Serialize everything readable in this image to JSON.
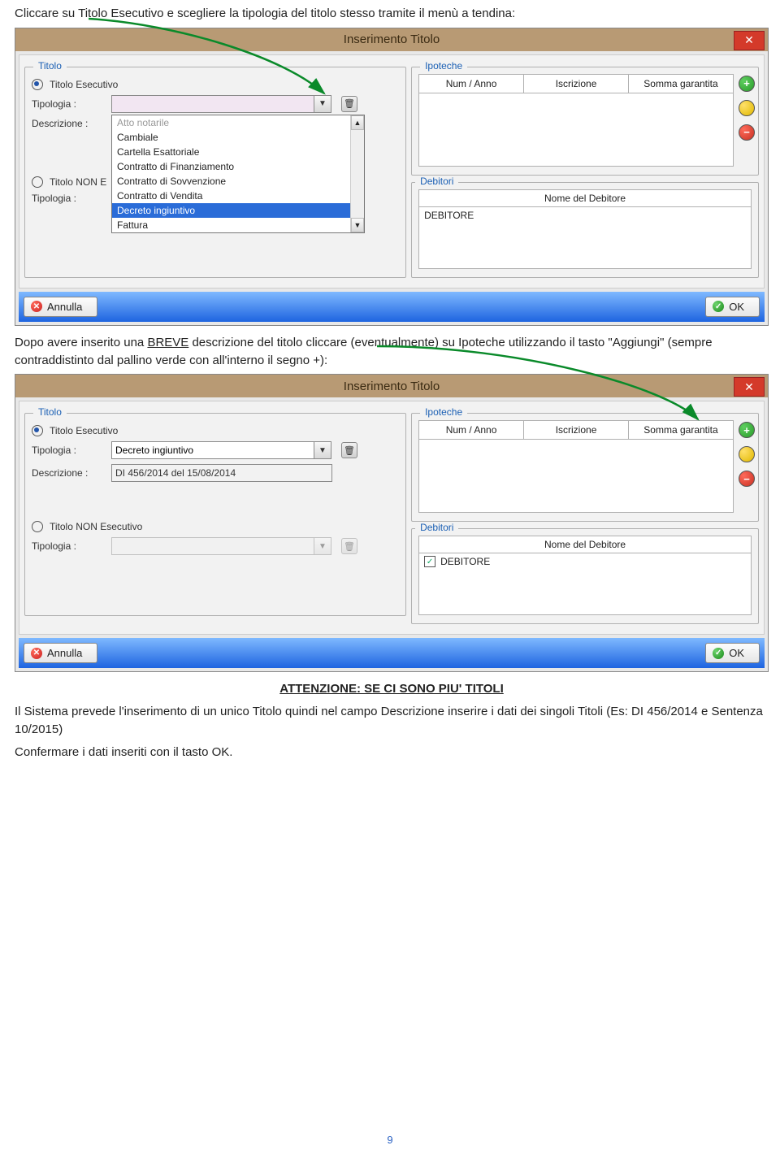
{
  "intro1": "Cliccare su Titolo Esecutivo e scegliere la tipologia del titolo stesso tramite il menù a tendina:",
  "win": {
    "title": "Inserimento Titolo",
    "grp_titolo": "Titolo",
    "grp_ipoteche": "Ipoteche",
    "grp_debitori": "Debitori",
    "radio_esec": "Titolo Esecutivo",
    "radio_non": "Titolo NON Esecutivo",
    "lbl_tipologia": "Tipologia :",
    "lbl_descrizione": "Descrizione :",
    "ipo_h1": "Num / Anno",
    "ipo_h2": "Iscrizione",
    "ipo_h3": "Somma garantita",
    "deb_header": "Nome del Debitore",
    "deb_row": "DEBITORE",
    "btn_annulla": "Annulla",
    "btn_ok": "OK"
  },
  "dropdown": {
    "opt0": "Atto notarile",
    "opt1": "Cambiale",
    "opt2": "Cartella Esattoriale",
    "opt3": "Contratto di Finanziamento",
    "opt4": "Contratto di Sovvenzione",
    "opt5": "Contratto di Vendita",
    "opt6": "Decreto ingiuntivo",
    "opt7": "Fattura"
  },
  "mid_text": "Dopo avere inserito una BREVE descrizione del titolo cliccare (eventualmente) su Ipoteche utilizzando il tasto \"Aggiungi\" (sempre contraddistinto dal pallino verde con all'interno il segno +):",
  "mid_breve": "BREVE",
  "win2": {
    "tipologia_val": "Decreto ingiuntivo",
    "descr_val": "DI 456/2014 del 15/08/2014",
    "radio_non_trunc": "Titolo NON E"
  },
  "attention": "ATTENZIONE: SE CI SONO PIU' TITOLI",
  "para2": "Il Sistema prevede l'inserimento di un unico Titolo quindi nel campo Descrizione inserire i dati dei singoli Titoli (Es: DI 456/2014 e Sentenza 10/2015)",
  "para3": "Confermare i dati inseriti con il tasto OK.",
  "pagenum": "9"
}
